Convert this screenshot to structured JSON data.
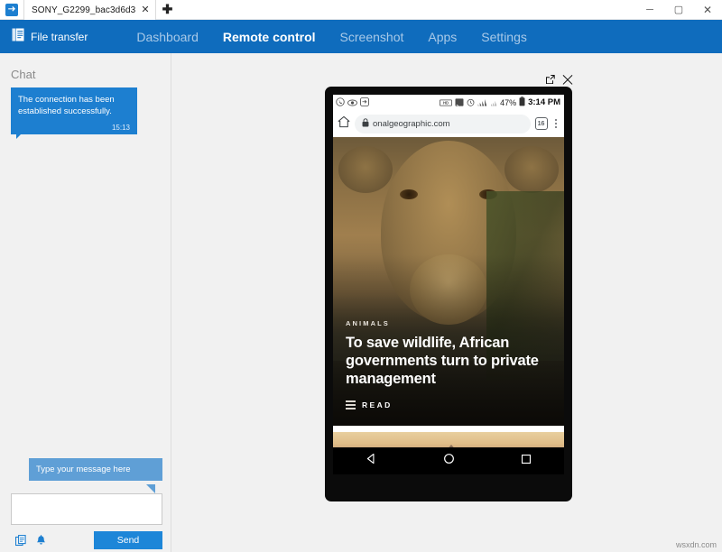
{
  "window": {
    "tab_title": "SONY_G2299_bac3d6d3",
    "tab_close_label": "✕",
    "new_tab_label": "✚",
    "minimize_label": "─",
    "maximize_label": "▢",
    "close_label": "✕",
    "app_icon": "device-sync-icon"
  },
  "header": {
    "file_transfer_label": "File transfer",
    "file_transfer_icon": "file-transfer-icon",
    "accent_color": "#0f6cbd",
    "nav": [
      {
        "label": "Dashboard",
        "active": false
      },
      {
        "label": "Remote control",
        "active": true
      },
      {
        "label": "Screenshot",
        "active": false
      },
      {
        "label": "Apps",
        "active": false
      },
      {
        "label": "Settings",
        "active": false
      }
    ]
  },
  "sidebar": {
    "title": "Chat",
    "message": {
      "text": "The connection has been established successfully.",
      "time": "15:13",
      "bubble_color": "#1d7fd0"
    },
    "tooltip": "Type your message here",
    "input_value": "",
    "input_placeholder": "",
    "clipboard_icon": "clipboard-icon",
    "bell_icon": "bell-icon",
    "send_label": "Send",
    "send_color": "#1d86d8"
  },
  "phone": {
    "popout_icon": "popout-icon",
    "close_icon": "close-icon",
    "statusbar": {
      "left_icons": [
        "whatsapp-icon",
        "eye-icon",
        "app-icon"
      ],
      "right_icons": [
        "data-icon",
        "cast-icon",
        "alarm-icon",
        "signal-icon",
        "signal2-icon"
      ],
      "battery_percent": "47%",
      "battery_icon": "battery-icon",
      "time": "3:14 PM"
    },
    "browser": {
      "home_icon": "home-icon",
      "lock_icon": "lock-icon",
      "url": "onalgeographic.com",
      "tab_count": "16",
      "menu_icon": "kebab-menu-icon"
    },
    "article": {
      "kicker": "ANIMALS",
      "headline": "To save wildlife, African governments turn to private management",
      "read_label": "READ",
      "read_icon": "menu-lines-icon"
    },
    "navbar": {
      "back_icon": "back-triangle-icon",
      "home_icon": "home-circle-icon",
      "recents_icon": "recents-square-icon"
    }
  },
  "watermark": "wsxdn.com"
}
